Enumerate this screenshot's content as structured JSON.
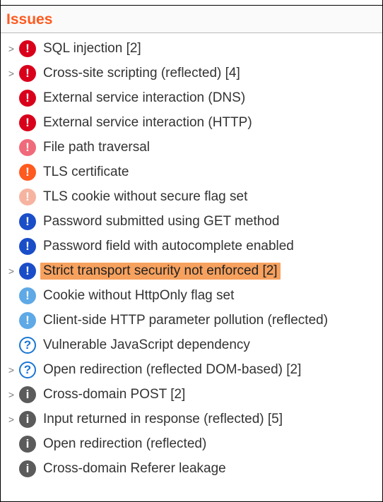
{
  "header": {
    "title": "Issues"
  },
  "glyphs": {
    "bang": "!",
    "question": "?",
    "info": "i",
    "expander": ">"
  },
  "issues": [
    {
      "label": "SQL injection [2]",
      "severity": "red",
      "glyph": "bang",
      "expandable": true,
      "selected": false
    },
    {
      "label": "Cross-site scripting (reflected) [4]",
      "severity": "red",
      "glyph": "bang",
      "expandable": true,
      "selected": false
    },
    {
      "label": "External service interaction (DNS)",
      "severity": "red",
      "glyph": "bang",
      "expandable": false,
      "selected": false
    },
    {
      "label": "External service interaction (HTTP)",
      "severity": "red",
      "glyph": "bang",
      "expandable": false,
      "selected": false
    },
    {
      "label": "File path traversal",
      "severity": "red-lt",
      "glyph": "bang",
      "expandable": false,
      "selected": false
    },
    {
      "label": "TLS certificate",
      "severity": "orange",
      "glyph": "bang",
      "expandable": false,
      "selected": false
    },
    {
      "label": "TLS cookie without secure flag set",
      "severity": "peach",
      "glyph": "bang",
      "expandable": false,
      "selected": false
    },
    {
      "label": "Password submitted using GET method",
      "severity": "blue",
      "glyph": "bang",
      "expandable": false,
      "selected": false
    },
    {
      "label": "Password field with autocomplete enabled",
      "severity": "blue",
      "glyph": "bang",
      "expandable": false,
      "selected": false
    },
    {
      "label": "Strict transport security not enforced [2]",
      "severity": "blue",
      "glyph": "bang",
      "expandable": true,
      "selected": true
    },
    {
      "label": "Cookie without HttpOnly flag set",
      "severity": "blue-lt",
      "glyph": "bang",
      "expandable": false,
      "selected": false
    },
    {
      "label": "Client-side HTTP parameter pollution (reflected)",
      "severity": "blue-lt",
      "glyph": "bang",
      "expandable": false,
      "selected": false
    },
    {
      "label": "Vulnerable JavaScript dependency",
      "severity": "outline",
      "glyph": "question",
      "expandable": false,
      "selected": false
    },
    {
      "label": "Open redirection (reflected DOM-based) [2]",
      "severity": "outline",
      "glyph": "question",
      "expandable": true,
      "selected": false
    },
    {
      "label": "Cross-domain POST [2]",
      "severity": "grey",
      "glyph": "info",
      "expandable": true,
      "selected": false
    },
    {
      "label": "Input returned in response (reflected) [5]",
      "severity": "grey",
      "glyph": "info",
      "expandable": true,
      "selected": false
    },
    {
      "label": "Open redirection (reflected)",
      "severity": "grey",
      "glyph": "info",
      "expandable": false,
      "selected": false
    },
    {
      "label": "Cross-domain Referer leakage",
      "severity": "grey",
      "glyph": "info",
      "expandable": false,
      "selected": false
    }
  ]
}
